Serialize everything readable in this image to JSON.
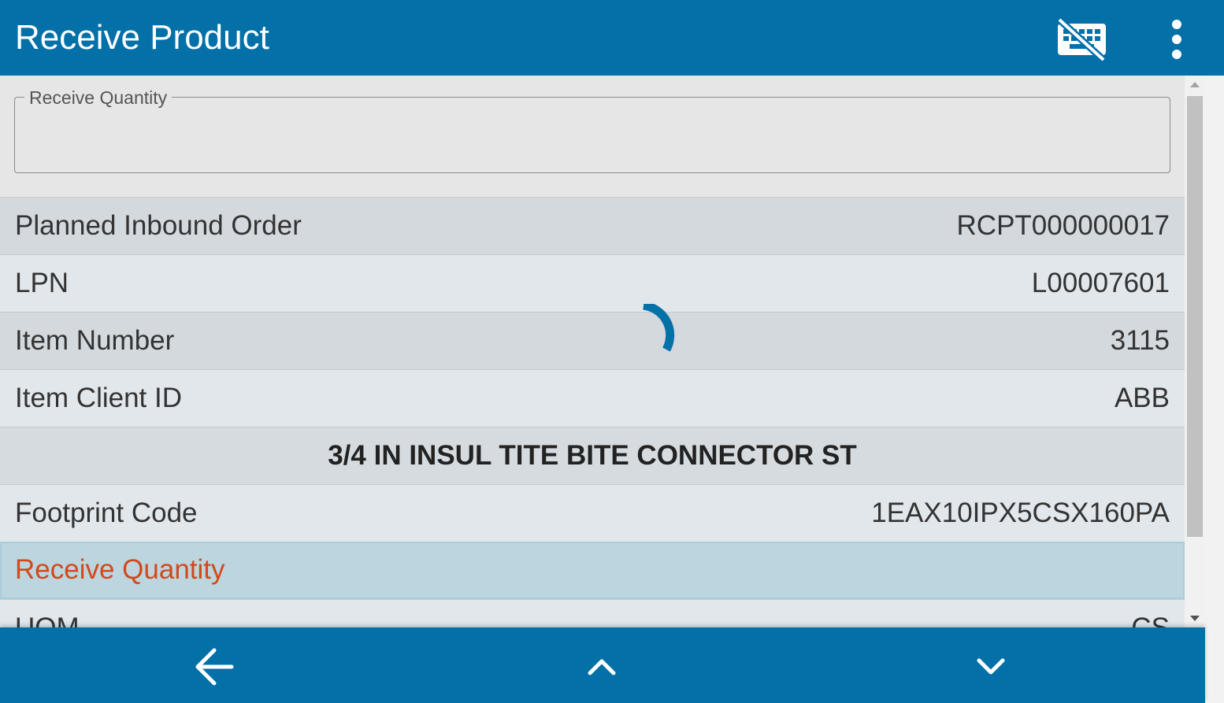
{
  "header": {
    "title": "Receive Product",
    "keyboard_icon": "keyboard-off-icon",
    "menu_icon": "more-vert-icon"
  },
  "input": {
    "label": "Receive Quantity",
    "value": ""
  },
  "rows": [
    {
      "label": "Planned Inbound Order",
      "value": "RCPT000000017"
    },
    {
      "label": "LPN",
      "value": "L00007601"
    },
    {
      "label": "Item Number",
      "value": "3115"
    },
    {
      "label": "Item Client ID",
      "value": "ABB"
    }
  ],
  "description": "3/4 IN INSUL TITE BITE CONNECTOR ST",
  "footprint": {
    "label": "Footprint Code",
    "value": "1EAX10IPX5CSX160PA"
  },
  "active_row": {
    "label": "Receive Quantity"
  },
  "uom": {
    "label": "UOM",
    "value": "CS"
  },
  "footer": {
    "back_icon": "arrow-left-icon",
    "up_icon": "chevron-up-icon",
    "down_icon": "chevron-down-icon"
  },
  "colors": {
    "primary": "#0370a8",
    "active_label": "#d1491c",
    "active_bg": "#bcd5de"
  }
}
